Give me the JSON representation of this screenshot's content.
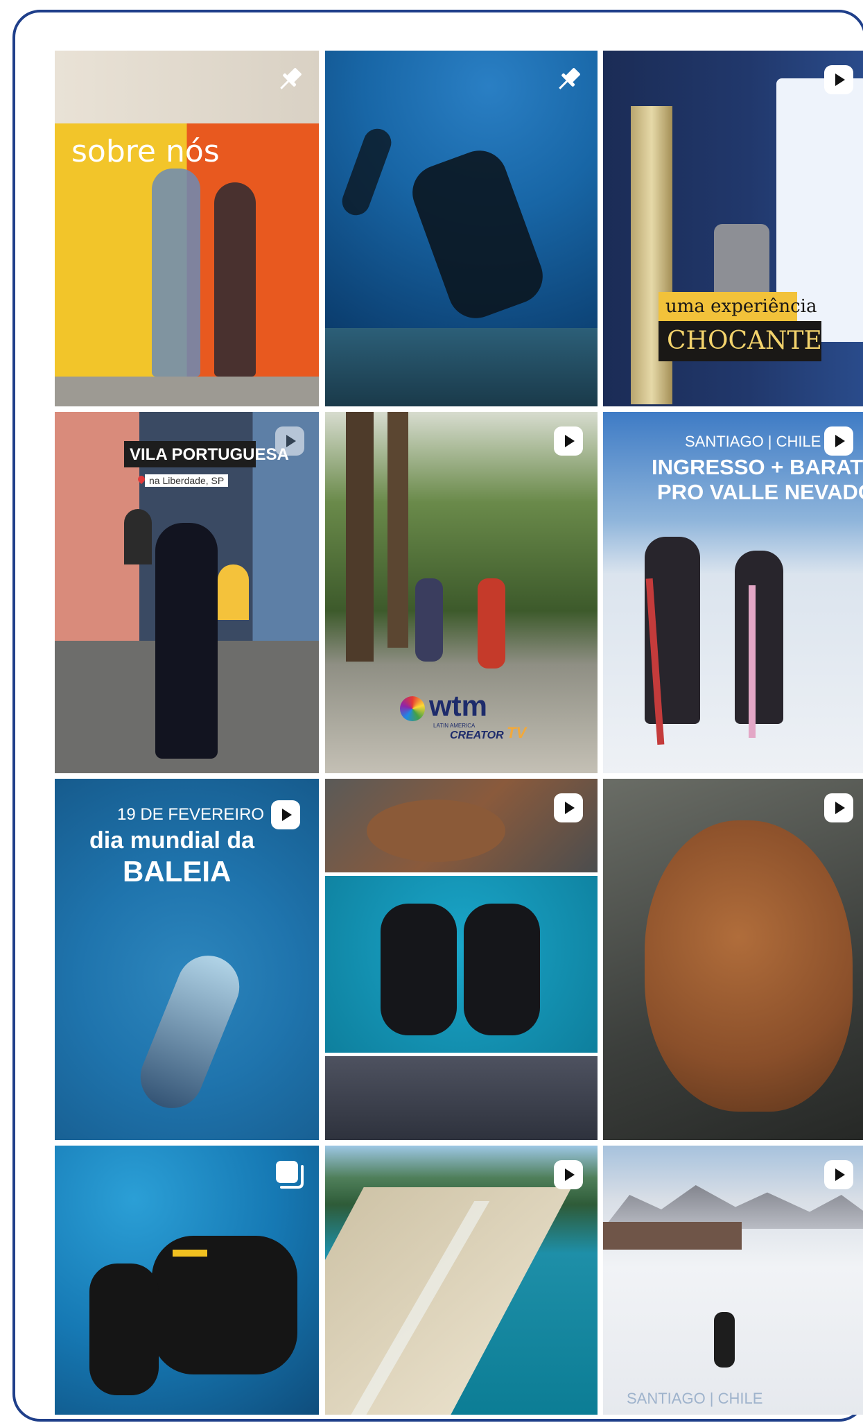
{
  "colors": {
    "frame_border": "#1f3f8a",
    "icon_white": "#ffffff"
  },
  "posts": [
    {
      "row": 1,
      "col": 1,
      "type": "pinned",
      "icon": "pin-icon",
      "overlay": {
        "title": "sobre nós"
      }
    },
    {
      "row": 1,
      "col": 2,
      "type": "pinned",
      "icon": "pin-icon"
    },
    {
      "row": 1,
      "col": 3,
      "type": "reel",
      "icon": "reel-play-icon",
      "overlay": {
        "line1": "uma experiência",
        "line2": "CHOCANTE"
      }
    },
    {
      "row": 2,
      "col": 1,
      "type": "reel",
      "icon": "reel-play-icon",
      "overlay": {
        "title": "VILA PORTUGUESA",
        "location": "na Liberdade, SP"
      }
    },
    {
      "row": 2,
      "col": 2,
      "type": "reel",
      "icon": "reel-play-icon",
      "overlay": {
        "logo": "wtm",
        "logo_sub1": "LATIN AMERICA",
        "logo_sub2": "CREATOR",
        "logo_sub3": "TV"
      }
    },
    {
      "row": 2,
      "col": 3,
      "type": "reel",
      "icon": "reel-play-icon",
      "overlay": {
        "kicker": "SANTIAGO | CHILE",
        "line1": "INGRESSO + BARATO",
        "line2": "PRO VALLE NEVADO"
      }
    },
    {
      "row": 3,
      "col": 1,
      "type": "reel",
      "icon": "reel-play-icon",
      "overlay": {
        "kicker": "19 DE FEVEREIRO",
        "line1": "dia mundial da",
        "line2": "BALEIA"
      }
    },
    {
      "row": 3,
      "col": 2,
      "type": "reel",
      "icon": "reel-play-icon"
    },
    {
      "row": 3,
      "col": 3,
      "type": "reel",
      "icon": "reel-play-icon"
    },
    {
      "row": 4,
      "col": 1,
      "type": "carousel",
      "icon": "carousel-icon"
    },
    {
      "row": 4,
      "col": 2,
      "type": "reel",
      "icon": "reel-play-icon"
    },
    {
      "row": 4,
      "col": 3,
      "type": "reel",
      "icon": "reel-play-icon",
      "overlay": {
        "caption": "SANTIAGO | CHILE"
      }
    }
  ]
}
